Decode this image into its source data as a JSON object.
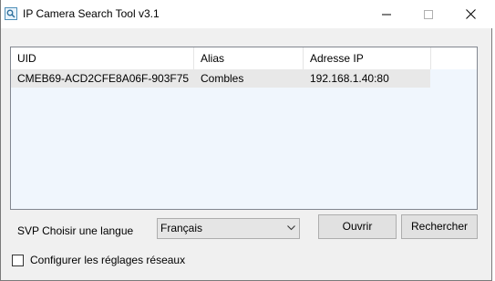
{
  "window": {
    "title": "IP Camera Search Tool  v3.1",
    "controls": {
      "minimize_icon": "minimize-icon",
      "maximize_icon": "maximize-icon",
      "close_icon": "close-icon"
    }
  },
  "list": {
    "columns": [
      "UID",
      "Alias",
      "Adresse IP"
    ],
    "rows": [
      {
        "uid": "CMEB69-ACD2CFE8A06F-903F75",
        "alias": "Combles",
        "ip": "192.168.1.40:80"
      }
    ]
  },
  "language": {
    "label": "SVP Choisir une langue",
    "selected": "Français"
  },
  "buttons": {
    "open": "Ouvrir",
    "search": "Rechercher"
  },
  "network_settings": {
    "label": "Configurer les réglages réseaux",
    "checked": false
  },
  "colors": {
    "window_bg": "#f0f0f0",
    "list_body_bg": "#f0f6fd",
    "row_bg": "#e8e8e8",
    "button_bg": "#e1e1e1"
  }
}
